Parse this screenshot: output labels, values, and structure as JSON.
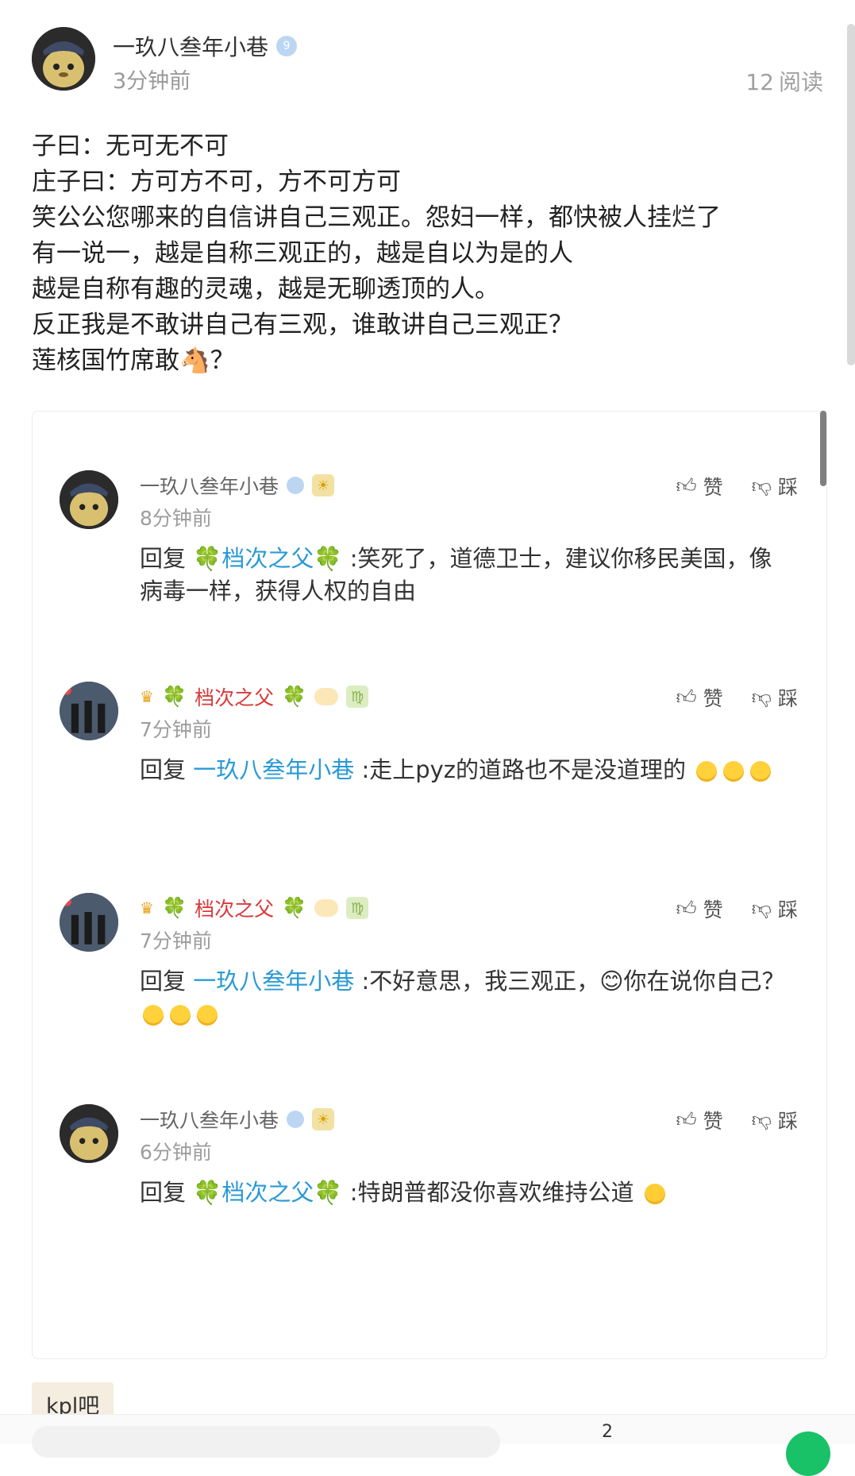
{
  "post": {
    "author": "一玖八叁年小巷",
    "vip_level": "9",
    "time": "3分钟前",
    "reads_count": "12",
    "reads_label": "阅读",
    "lines": [
      "子曰：无可无不可",
      "庄子曰：方可方不可，方不可方可",
      "笑公公您哪来的自信讲自己三观正。怨妇一样，都快被人挂烂了",
      "有一说一，越是自称三观正的，越是自以为是的人",
      "越是自称有趣的灵魂，越是无聊透顶的人。",
      "反正我是不敢讲自己有三观，谁敢讲自己三观正？",
      "莲核国竹席敢🐴？"
    ]
  },
  "replies": [
    {
      "user": "一玖八叁年小巷",
      "time": "8分钟前",
      "reply_prefix": "回复",
      "target": "档次之父",
      "target_clovers": true,
      "text": ":笑死了，道德卫士，建议你移民美国，像病毒一样，获得人权的自由",
      "emojis": 0,
      "like": "赞",
      "dislike": "踩"
    },
    {
      "user": "档次之父",
      "time": "7分钟前",
      "reply_prefix": "回复",
      "target": "一玖八叁年小巷",
      "target_clovers": false,
      "text": ":走上pyz的道路也不是没道理的",
      "emojis": 3,
      "like": "赞",
      "dislike": "踩"
    },
    {
      "user": "档次之父",
      "time": "7分钟前",
      "reply_prefix": "回复",
      "target": "一玖八叁年小巷",
      "target_clovers": false,
      "text": ":不好意思，我三观正，😊你在说你自己？",
      "emojis": 3,
      "like": "赞",
      "dislike": "踩"
    },
    {
      "user": "一玖八叁年小巷",
      "time": "6分钟前",
      "reply_prefix": "回复",
      "target": "档次之父",
      "target_clovers": true,
      "text": ":特朗普都没你喜欢维持公道",
      "emojis": 1,
      "like": "赞",
      "dislike": "踩"
    }
  ],
  "forum_tag": "kpl吧",
  "bottom": {
    "comment_count": "2"
  },
  "colors": {
    "link": "#2a9ad6",
    "clover": "#29a84a",
    "red_name": "#d93a3a",
    "send_green": "#19c266"
  }
}
